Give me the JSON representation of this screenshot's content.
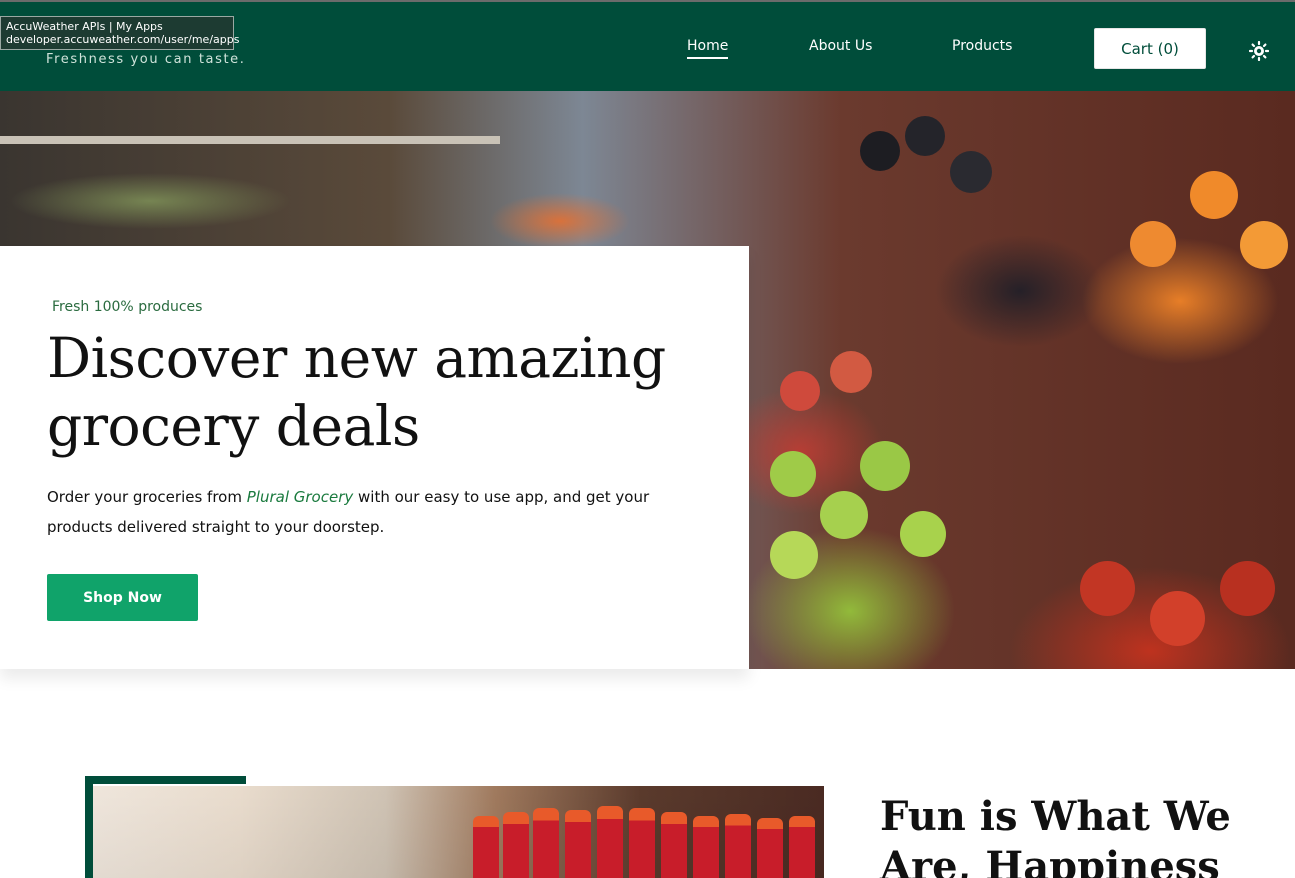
{
  "browser_tooltip": {
    "title": "AccuWeather APIs | My Apps",
    "url": "developer.accuweather.com/user/me/apps"
  },
  "header": {
    "tagline": "Freshness you can taste.",
    "nav": [
      {
        "label": "Home",
        "active": true
      },
      {
        "label": "About Us",
        "active": false
      },
      {
        "label": "Products",
        "active": false
      }
    ],
    "cart_label": "Cart (0)",
    "theme_icon": "sun-icon",
    "bg_color": "#004d3a"
  },
  "hero": {
    "eyebrow": "Fresh 100% produces",
    "headline": "Discover new amazing grocery deals",
    "desc_before": "Order your groceries from ",
    "desc_brand": "Plural Grocery",
    "desc_after": " with our easy to use app, and get your products delivered straight to your doorstep.",
    "cta_label": "Shop Now",
    "cta_color": "#10a36a"
  },
  "about": {
    "title": "Fun is What We Are, Happiness"
  }
}
